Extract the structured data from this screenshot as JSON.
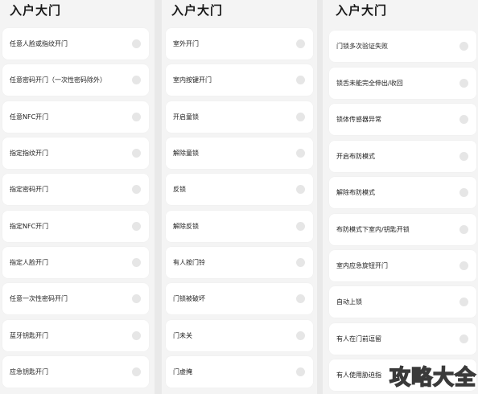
{
  "panels": [
    {
      "title": "入户大门",
      "items": [
        "任意人脸或指纹开门",
        "任意密码开门（一次性密码除外）",
        "任意NFC开门",
        "指定指纹开门",
        "指定密码开门",
        "指定NFC开门",
        "指定人脸开门",
        "任意一次性密码开门",
        "蓝牙钥匙开门",
        "应急钥匙开门"
      ]
    },
    {
      "title": "入户大门",
      "items": [
        "室外开门",
        "室内按键开门",
        "开启童锁",
        "解除童锁",
        "反锁",
        "解除反锁",
        "有人按门铃",
        "门锁被破坏",
        "门未关",
        "门虚掩"
      ]
    },
    {
      "title": "入户大门",
      "items": [
        "门锁多次验证失败",
        "锁舌未能完全伸出/收回",
        "锁体传感器异常",
        "开启布防模式",
        "解除布防模式",
        "布防模式下室内/钥匙开锁",
        "室内应急旋钮开门",
        "自动上锁",
        "有人在门前逗留",
        "有人使用胁迫指"
      ]
    }
  ],
  "watermark": "攻略大全"
}
